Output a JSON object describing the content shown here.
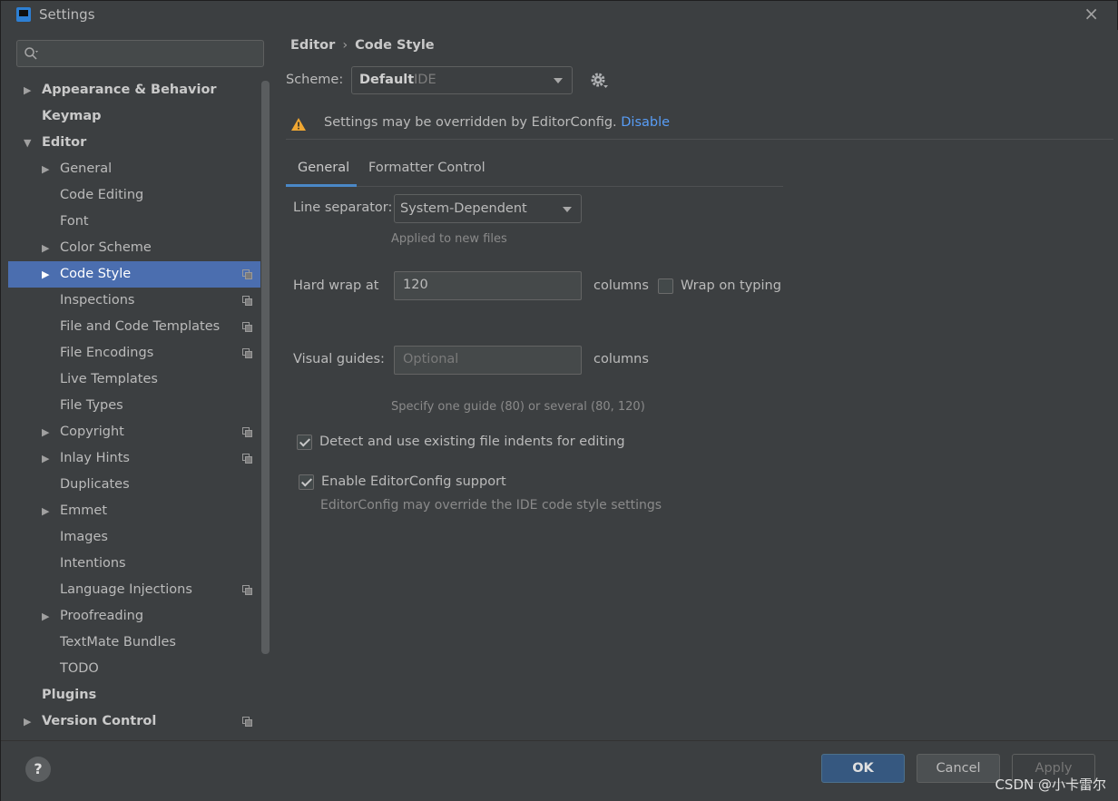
{
  "window": {
    "title": "Settings"
  },
  "sidebar": {
    "search": {
      "placeholder": ""
    },
    "items": [
      {
        "label": "Appearance & Behavior",
        "level": 0,
        "arrow": "▶",
        "bold": true,
        "copy": false
      },
      {
        "label": "Keymap",
        "level": 0,
        "arrow": "",
        "bold": true,
        "copy": false
      },
      {
        "label": "Editor",
        "level": 0,
        "arrow": "▼",
        "bold": true,
        "copy": false
      },
      {
        "label": "General",
        "level": 1,
        "arrow": "▶",
        "bold": false,
        "copy": false
      },
      {
        "label": "Code Editing",
        "level": 1,
        "arrow": "",
        "bold": false,
        "copy": false
      },
      {
        "label": "Font",
        "level": 1,
        "arrow": "",
        "bold": false,
        "copy": false
      },
      {
        "label": "Color Scheme",
        "level": 1,
        "arrow": "▶",
        "bold": false,
        "copy": false
      },
      {
        "label": "Code Style",
        "level": 1,
        "arrow": "▶",
        "bold": false,
        "copy": true,
        "selected": true
      },
      {
        "label": "Inspections",
        "level": 1,
        "arrow": "",
        "bold": false,
        "copy": true
      },
      {
        "label": "File and Code Templates",
        "level": 1,
        "arrow": "",
        "bold": false,
        "copy": true
      },
      {
        "label": "File Encodings",
        "level": 1,
        "arrow": "",
        "bold": false,
        "copy": true
      },
      {
        "label": "Live Templates",
        "level": 1,
        "arrow": "",
        "bold": false,
        "copy": false
      },
      {
        "label": "File Types",
        "level": 1,
        "arrow": "",
        "bold": false,
        "copy": false
      },
      {
        "label": "Copyright",
        "level": 1,
        "arrow": "▶",
        "bold": false,
        "copy": true
      },
      {
        "label": "Inlay Hints",
        "level": 1,
        "arrow": "▶",
        "bold": false,
        "copy": true
      },
      {
        "label": "Duplicates",
        "level": 1,
        "arrow": "",
        "bold": false,
        "copy": false
      },
      {
        "label": "Emmet",
        "level": 1,
        "arrow": "▶",
        "bold": false,
        "copy": false
      },
      {
        "label": "Images",
        "level": 1,
        "arrow": "",
        "bold": false,
        "copy": false
      },
      {
        "label": "Intentions",
        "level": 1,
        "arrow": "",
        "bold": false,
        "copy": false
      },
      {
        "label": "Language Injections",
        "level": 1,
        "arrow": "",
        "bold": false,
        "copy": true
      },
      {
        "label": "Proofreading",
        "level": 1,
        "arrow": "▶",
        "bold": false,
        "copy": false
      },
      {
        "label": "TextMate Bundles",
        "level": 1,
        "arrow": "",
        "bold": false,
        "copy": false
      },
      {
        "label": "TODO",
        "level": 1,
        "arrow": "",
        "bold": false,
        "copy": false
      },
      {
        "label": "Plugins",
        "level": 0,
        "arrow": "",
        "bold": true,
        "copy": false
      },
      {
        "label": "Version Control",
        "level": 0,
        "arrow": "▶",
        "bold": true,
        "copy": true
      }
    ]
  },
  "breadcrumb": {
    "parent": "Editor",
    "separator": "›",
    "current": "Code Style"
  },
  "scheme": {
    "label": "Scheme:",
    "value": "Default",
    "scope": "IDE"
  },
  "notice": {
    "text": "Settings may be overridden by EditorConfig.",
    "link": "Disable"
  },
  "tabs": [
    {
      "label": "General",
      "active": true
    },
    {
      "label": "Formatter Control",
      "active": false
    }
  ],
  "general": {
    "line_separator_label": "Line separator:",
    "line_separator_value": "System-Dependent",
    "line_separator_hint": "Applied to new files",
    "hard_wrap_label": "Hard wrap at",
    "hard_wrap_value": "120",
    "hard_wrap_unit": "columns",
    "wrap_on_typing_label": "Wrap on typing",
    "wrap_on_typing_checked": false,
    "visual_guides_label": "Visual guides:",
    "visual_guides_placeholder": "Optional",
    "visual_guides_unit": "columns",
    "visual_guides_hint": "Specify one guide (80) or several (80, 120)",
    "detect_indents_label": "Detect and use existing file indents for editing",
    "detect_indents_checked": true,
    "editorconfig_label": "Enable EditorConfig support",
    "editorconfig_checked": true,
    "editorconfig_hint": "EditorConfig may override the IDE code style settings"
  },
  "footer": {
    "help": "?",
    "ok": "OK",
    "cancel": "Cancel",
    "apply": "Apply"
  },
  "watermark": "CSDN @小卡雷尔",
  "colors": {
    "selection": "#4b6eaf",
    "accent": "#4a88c7",
    "link": "#589df6",
    "warning": "#f0a732"
  }
}
